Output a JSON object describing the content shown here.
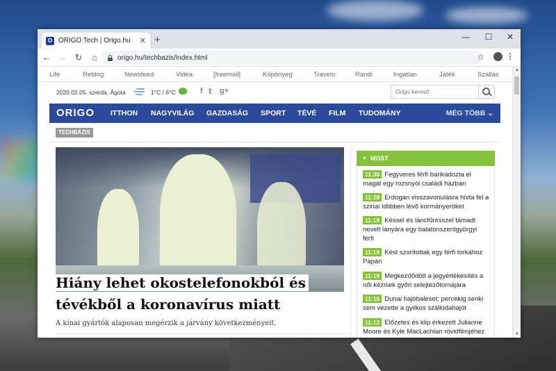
{
  "browser": {
    "tab_title": "ORIGO Tech | Origo.hu",
    "tab_favicon": "O",
    "new_tab": "+",
    "url": "origo.hu/techbazis/index.html",
    "controls": {
      "minimize": "—",
      "maximize": "☐",
      "close": "✕"
    }
  },
  "top_links": [
    "Life",
    "Reblog",
    "Newsfeed",
    "Videa",
    "[freemail]",
    "Köpönyeg",
    "Travelo",
    "Randi",
    "Ingatlan",
    "Játék",
    "Szállás"
  ],
  "infobar": {
    "date": "2020.02.05. szerda, Ágota",
    "temperature": "1°C / 6°C",
    "social": [
      "f",
      "𝕥",
      "g+"
    ],
    "search_placeholder": "Origo kereső"
  },
  "nav": {
    "logo": "ORIGO",
    "items": [
      "ITTHON",
      "NAGYVILÁG",
      "GAZDASÁG",
      "SPORT",
      "TÉVÉ",
      "FILM",
      "TUDOMÁNY"
    ],
    "more": "MÉG TÖBB ⌄"
  },
  "section_tag": "TECHBÁZIS",
  "article": {
    "headline_line1": "Hiány lehet okostelefonokból és",
    "headline_line2": "tévékből a koronavírus miatt",
    "lead": "A kínai gyártók alaposan megérzik a járvány következményeit."
  },
  "most": {
    "title": "MOST",
    "items": [
      {
        "time": "11:30",
        "text": "Fegyveres férfi barikádozta el magát egy rozsnyói családi házban"
      },
      {
        "time": "11:28",
        "text": "Erdogan visszavonulásra hívta fel a sziriai Idlibben lévő kormányeröket"
      },
      {
        "time": "11:19",
        "text": "Késsel és láncfűrésszel támadt nevelt lányára egy balatonszentgyörgyi férfi"
      },
      {
        "time": "11:19",
        "text": "Kést szorítottak egy férfi torkához Pápán"
      },
      {
        "time": "11:19",
        "text": "Megkezdődött a jegyértékesítés a női kézisek győri selejtezőtornájára"
      },
      {
        "time": "11:16",
        "text": "Dunai hajóbaleset: percekig senki sem vezette a gyilkos szállodahajót"
      },
      {
        "time": "11:12",
        "text": "Előzetes és klip érkezett Julianne Moore és Kyle MacLachlan rövidfilmjéhez"
      }
    ]
  },
  "colors": {
    "nav_blue": "#2b4a9b",
    "accent_green": "#84c23c",
    "tag_gray": "#9a9a9a"
  }
}
